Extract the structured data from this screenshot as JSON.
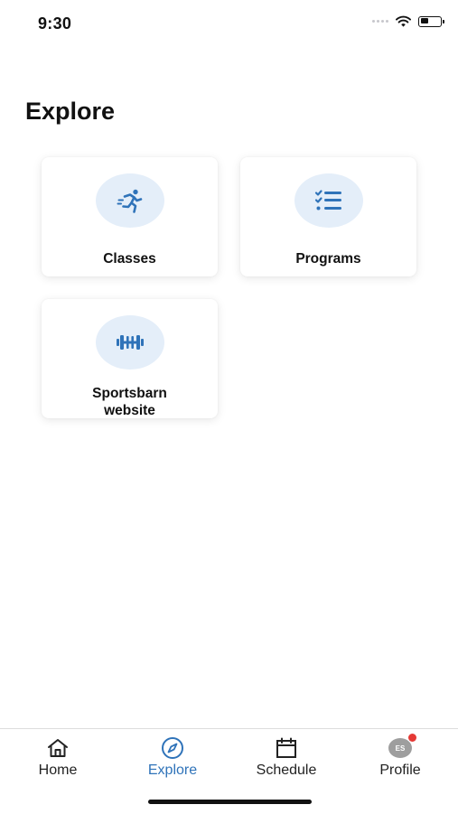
{
  "status_bar": {
    "time": "9:30",
    "battery_level": 0.4,
    "icons": [
      "signal-dots-icon",
      "wifi-icon",
      "battery-icon"
    ]
  },
  "page": {
    "title": "Explore"
  },
  "tiles": [
    {
      "label": "Classes",
      "icon": "running-person-icon"
    },
    {
      "label": "Programs",
      "icon": "checklist-icon"
    },
    {
      "label_line1": "Sportsbarn",
      "label_line2": "website",
      "icon": "dumbbell-icon"
    }
  ],
  "tab_bar": {
    "tabs": [
      {
        "label": "Home",
        "icon": "home-icon"
      },
      {
        "label": "Explore",
        "icon": "compass-icon",
        "active": true
      },
      {
        "label": "Schedule",
        "icon": "calendar-icon"
      },
      {
        "label": "Profile",
        "icon": "avatar",
        "avatar_initials": "ES",
        "has_notification": true
      }
    ]
  },
  "colors": {
    "accent": "#2f73b9",
    "icon_circle_bg": "#e4eef9",
    "notification": "#e53935",
    "avatar_bg": "#9e9e9e"
  }
}
